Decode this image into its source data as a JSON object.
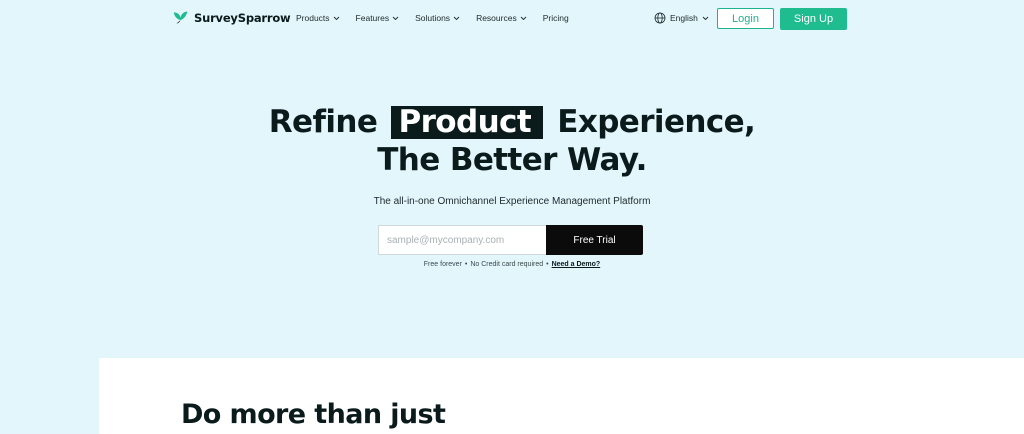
{
  "brand": {
    "name": "SurveySparrow",
    "accent": "#1ebc8f"
  },
  "nav": {
    "menu": [
      {
        "label": "Products",
        "has_dropdown": true
      },
      {
        "label": "Features",
        "has_dropdown": true
      },
      {
        "label": "Solutions",
        "has_dropdown": true
      },
      {
        "label": "Resources",
        "has_dropdown": true
      },
      {
        "label": "Pricing",
        "has_dropdown": false
      }
    ],
    "language": "English",
    "login_label": "Login",
    "signup_label": "Sign Up"
  },
  "hero": {
    "headline_before": "Refine",
    "headline_highlight": "Product",
    "headline_after": "Experience,",
    "headline_line2": "The Better Way.",
    "subheadline": "The all-in-one Omnichannel Experience Management Platform",
    "email_placeholder": "sample@mycompany.com",
    "cta_label": "Free Trial",
    "note_free": "Free forever",
    "note_card": "No Credit card required",
    "note_demo": "Need a Demo?"
  },
  "section": {
    "title": "Do more than just"
  }
}
